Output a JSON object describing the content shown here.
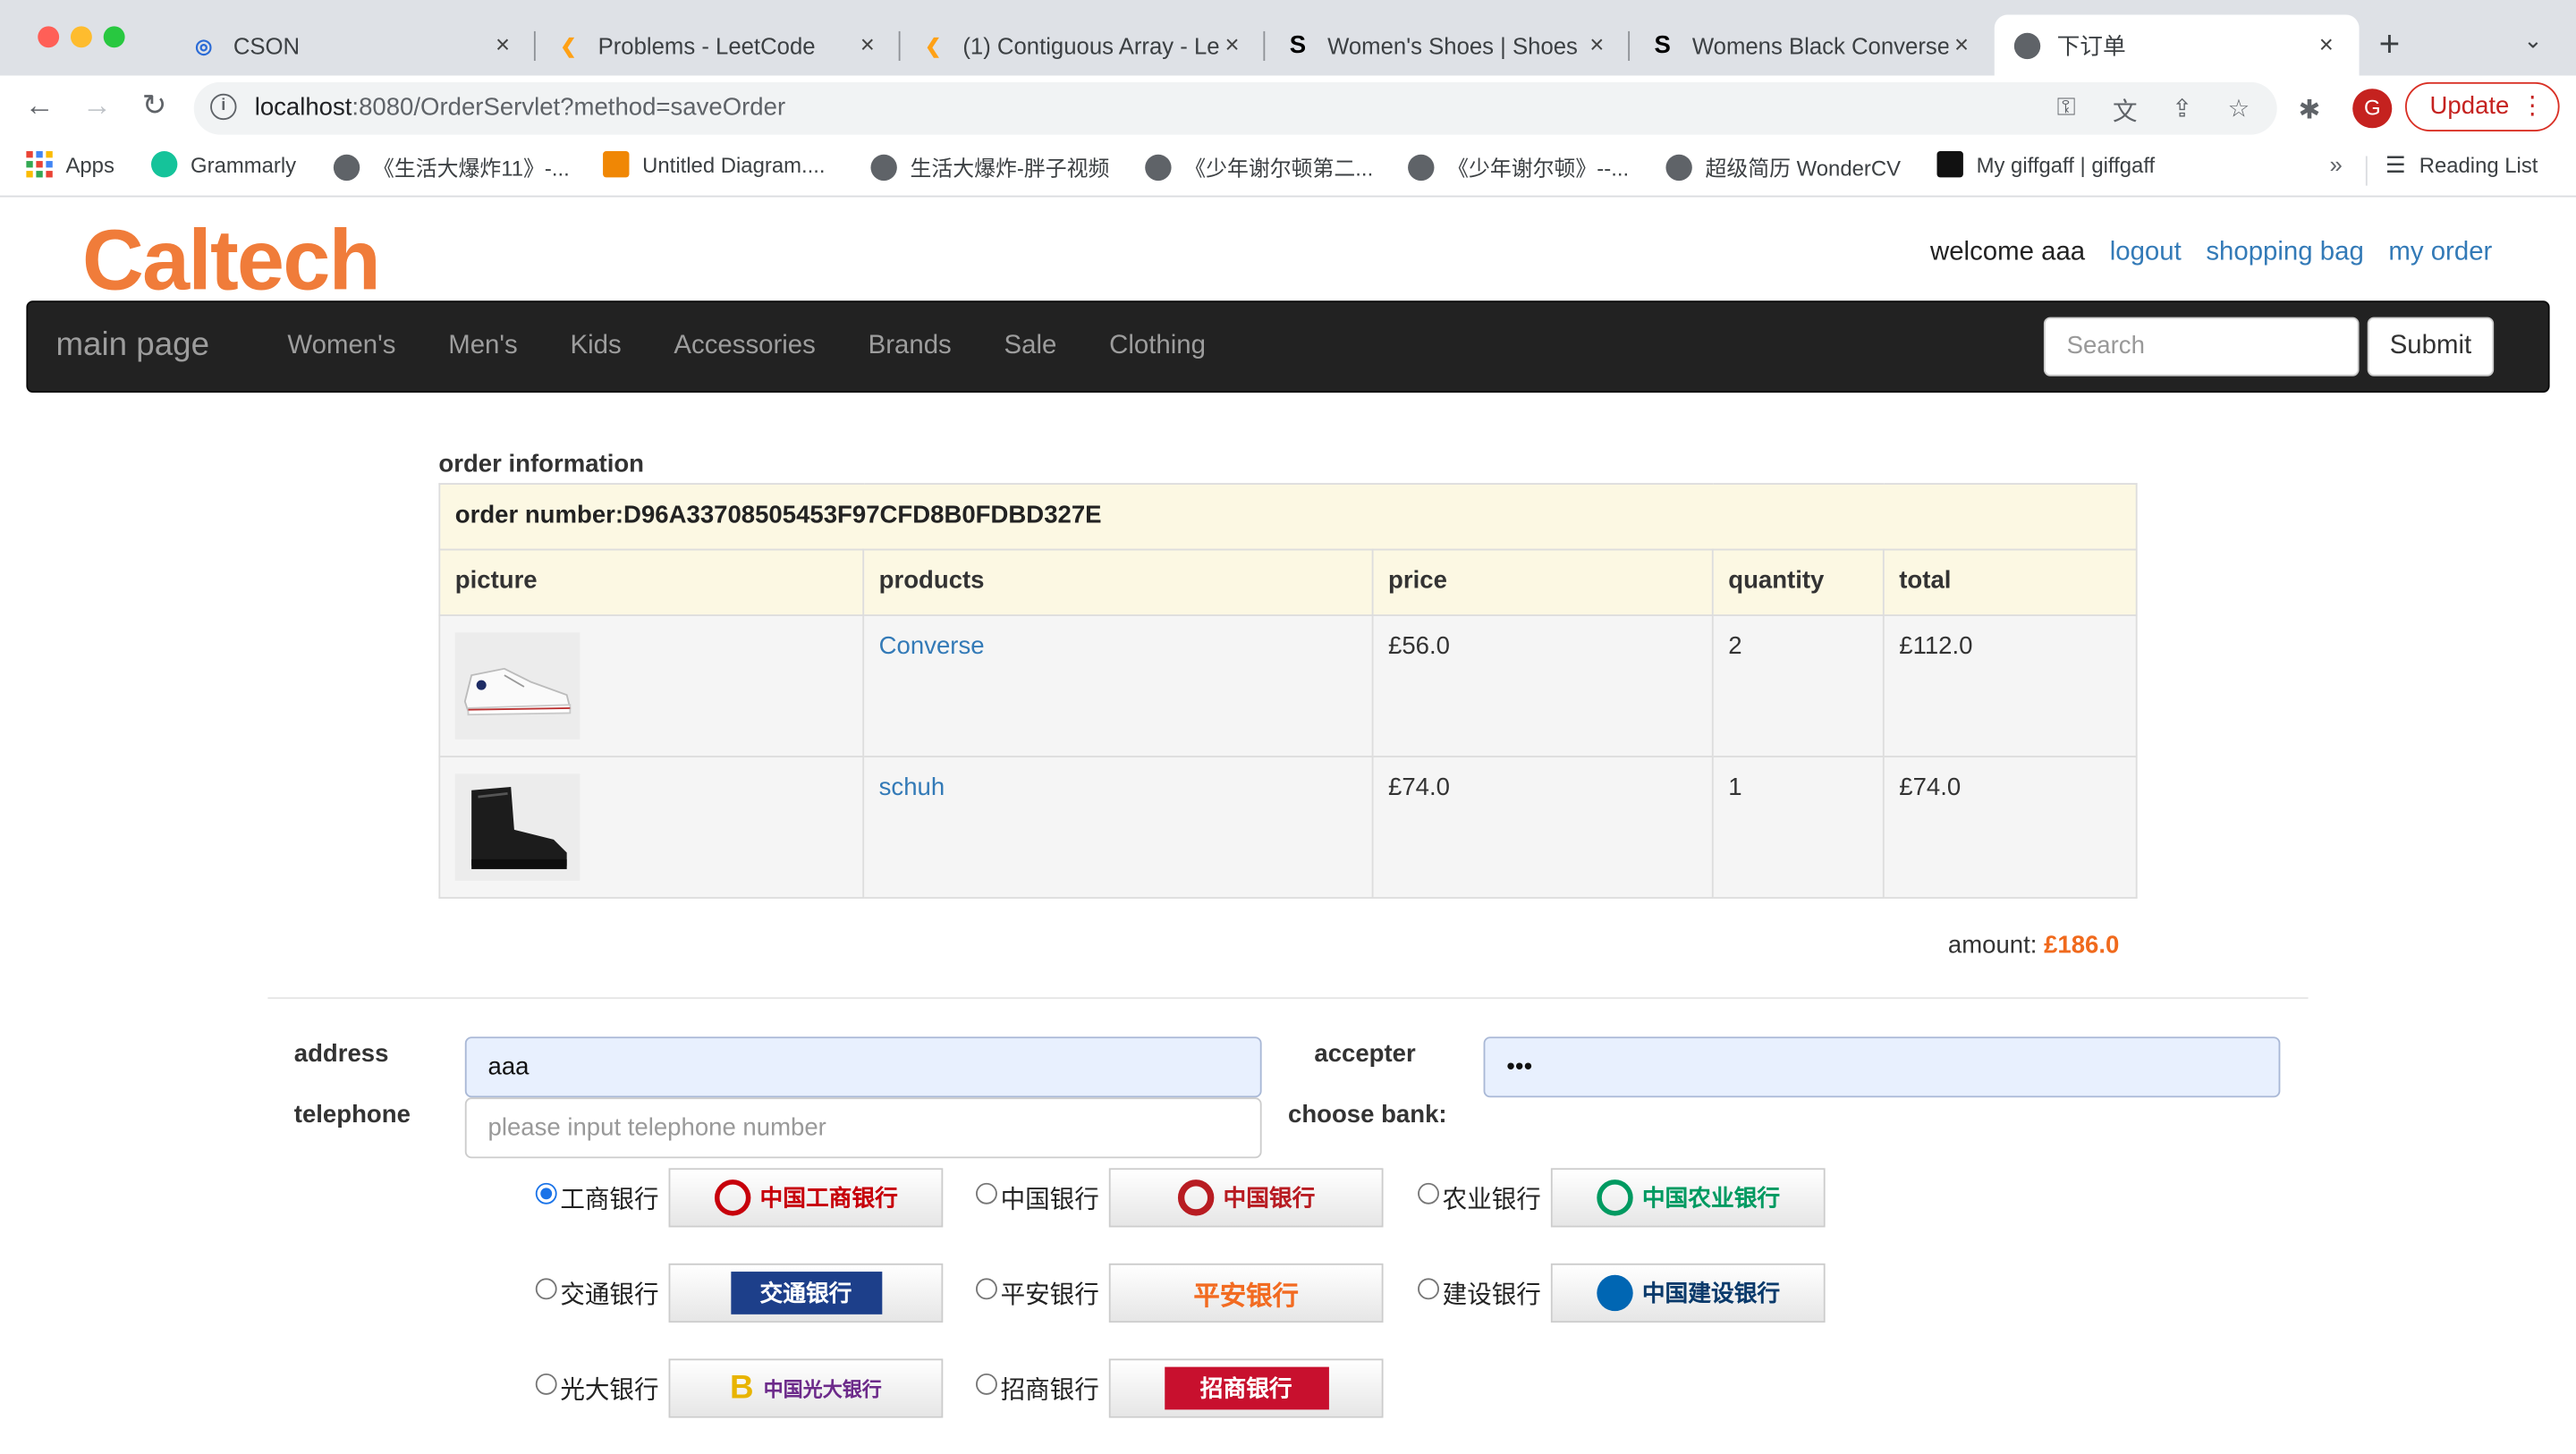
{
  "browser": {
    "tabs": [
      {
        "title": "CSON",
        "close": "×"
      },
      {
        "title": "Problems - LeetCode",
        "close": "×"
      },
      {
        "title": "(1) Contiguous Array - Le",
        "close": "×"
      },
      {
        "title": "Women's Shoes | Shoes",
        "close": "×"
      },
      {
        "title": "Womens Black Converse",
        "close": "×"
      },
      {
        "title": "下订单",
        "close": "×"
      }
    ],
    "new_tab": "+",
    "url_host": "localhost",
    "url_rest": ":8080/OrderServlet?method=saveOrder",
    "avatar_letter": "G",
    "update_label": "Update",
    "bookmarks": [
      "Apps",
      "Grammarly",
      "《生活大爆炸11》-...",
      "Untitled Diagram....",
      "生活大爆炸-胖子视频",
      "《少年谢尔顿第二...",
      "《少年谢尔顿》--...",
      "超级简历 WonderCV",
      "My giffgaff | giffgaff"
    ],
    "bookmarks_more": "»",
    "reading_list": "Reading List"
  },
  "site": {
    "logo": "Caltech",
    "welcome": "welcome aaa",
    "links": [
      "logout",
      "shopping bag",
      "my order"
    ],
    "brand": "main page",
    "nav": [
      "Women's",
      "Men's",
      "Kids",
      "Accessories",
      "Brands",
      "Sale",
      "Clothing"
    ],
    "search_placeholder": "Search",
    "submit_label": "Submit"
  },
  "order": {
    "caption": "order information",
    "number": "order number:D96A33708505453F97CFD8B0FDBD327E",
    "columns": [
      "picture",
      "products",
      "price",
      "quantity",
      "total"
    ],
    "items": [
      {
        "product": "Converse",
        "price": "£56.0",
        "quantity": "2",
        "total": "£112.0"
      },
      {
        "product": "schuh",
        "price": "£74.0",
        "quantity": "1",
        "total": "£74.0"
      }
    ],
    "amount_label": "amount: ",
    "amount_value": "£186.0"
  },
  "form": {
    "address_label": "address",
    "address_value": "aaa",
    "accepter_label": "accepter",
    "accepter_value": "•••",
    "telephone_label": "telephone",
    "telephone_placeholder": "please input telephone number",
    "bank_label": "choose bank:"
  },
  "banks": [
    {
      "name": "工商银行",
      "logo_text": "中国工商银行",
      "color": "#c7000b",
      "selected": true
    },
    {
      "name": "中国银行",
      "logo_text": "中国银行",
      "color": "#b81c22",
      "selected": false
    },
    {
      "name": "农业银行",
      "logo_text": "中国农业银行",
      "color": "#009a61",
      "selected": false
    },
    {
      "name": "交通银行",
      "logo_text": "交通银行",
      "color": "#1d3f8a",
      "selected": false
    },
    {
      "name": "平安银行",
      "logo_text": "平安银行",
      "color": "#f26b21",
      "selected": false
    },
    {
      "name": "建设银行",
      "logo_text": "中国建设银行",
      "color": "#0066b3",
      "selected": false
    },
    {
      "name": "光大银行",
      "logo_text": "中国光大银行",
      "color": "#6c2a8a",
      "selected": false
    },
    {
      "name": "招商银行",
      "logo_text": "招商银行",
      "color": "#c8102e",
      "selected": false
    }
  ]
}
